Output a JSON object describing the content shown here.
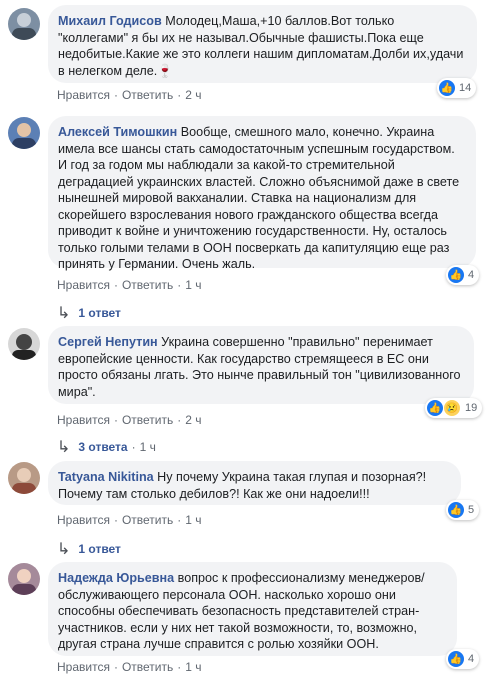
{
  "comments": [
    {
      "author": "Михаил Годисов",
      "text": " Молодец,Маша,+10 баллов.Вот только \"коллегами\" я бы их не называл.Обычные фашисты.Пока еще недобитые.Какие же это коллеги нашим дипломатам.Долби их,удачи в нелегком деле.🍷",
      "reactions": "14",
      "like": "Нравится",
      "reply": "Ответить",
      "time": "2 ч"
    },
    {
      "author": "Алексей Тимошкин",
      "text": " Вообще, смешного мало, конечно. Украина имела все шансы стать самодостаточным успешным государством. И год за годом мы наблюдали за какой-то стремительной деградацией украинских властей. Сложно объяснимой даже в свете нынешней мировой вакханалии. Ставка на национализм для скорейшего взрослевания нового гражданского общества всегда приводит к войне и уничтожению государственности. Ну, осталось только голыми телами в ООН посверкать да капитуляцию еще раз принять у Германии. Очень жаль.",
      "reactions": "4",
      "like": "Нравится",
      "reply": "Ответить",
      "time": "1 ч",
      "replies": "1 ответ"
    },
    {
      "author": "Сергей Непутин",
      "text": " Украина совершенно \"правильно\" перенимает европейские ценности. Как государство стремящееся в ЕС они просто обязаны лгать. Это нынче правильный тон \"цивилизованного мира\".",
      "reactions": "19",
      "like": "Нравится",
      "reply": "Ответить",
      "time": "2 ч",
      "replies": "3 ответа",
      "replies_time": "1 ч"
    },
    {
      "author": "Tatyana Nikitina",
      "text": " Ну почему Украина такая глупая и позорная?! Почему там столько дебилов?! Как же они надоели!!!",
      "reactions": "5",
      "like": "Нравится",
      "reply": "Ответить",
      "time": "1 ч",
      "replies": "1 ответ"
    },
    {
      "author": "Надежда Юрьевна",
      "text": " вопрос к профессионализму менеджеров/ обслуживающего персонала ООН. насколько хорошо они способны обеспечивать безопасность представителей стран-участников. если у них нет такой возможности, то, возможно, другая страна лучше справится с ролью хозяйки ООН.",
      "reactions": "4",
      "like": "Нравится",
      "reply": "Ответить",
      "time": "1 ч"
    }
  ],
  "colors": {
    "author": "#385898",
    "bubble": "#f2f3f5",
    "meta": "#606770",
    "like_icon": "#1877f2"
  },
  "icons": {
    "like": "like-icon",
    "sad": "sad-icon",
    "reply_arrow": "reply-arrow-icon"
  }
}
